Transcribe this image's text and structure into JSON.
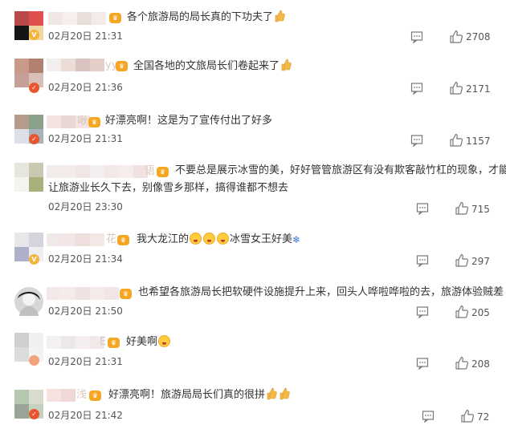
{
  "comments": [
    {
      "name_tail": "",
      "text": "各个旅游局的局长真的下功夫了",
      "time": "02月20日 21:31",
      "likes": "2708",
      "badge": "gold"
    },
    {
      "name_tail": "yy",
      "text": "全国各地的文旅局长们卷起来了",
      "time": "02月20日 21:36",
      "likes": "2171",
      "badge": "red"
    },
    {
      "name_tail": "啾",
      "text": "好漂亮啊！这是为了宣传付出了好多",
      "time": "02月20日 21:31",
      "likes": "1157",
      "badge": "red"
    },
    {
      "name_tail": "语",
      "text_line1": "不要总是展示冰雪的美，好好管管旅游区有没有欺客敲竹杠的现象，才能",
      "text_line2": "让旅游业长久下去，别像雪乡那样，搞得谁都不想去",
      "time": "02月20日 23:30",
      "likes": "715",
      "badge": "none"
    },
    {
      "name_tail": "花",
      "text_a": "我大龙江的",
      "text_b": "冰雪女王好美",
      "time": "02月20日 21:34",
      "likes": "297",
      "badge": "gold"
    },
    {
      "name_tail": "",
      "text": "也希望各旅游局长把软硬件设施提升上来，回头人哗啦哗啦的去，旅游体验贼差",
      "time": "02月20日 21:50",
      "likes": "205",
      "badge": "none"
    },
    {
      "name_tail": "E",
      "text": "好美啊",
      "time": "02月20日 21:31",
      "likes": "208",
      "badge": "orange"
    },
    {
      "name_tail": "浅",
      "text": "好漂亮啊！旅游局局长们真的很拼",
      "time": "02月20日 21:42",
      "likes": "72",
      "badge": "red"
    }
  ],
  "icons": {
    "reply": "comment-icon",
    "like": "thumbs-up-icon",
    "vip": "vip-crown-icon",
    "verified": "verified-badge-icon"
  }
}
